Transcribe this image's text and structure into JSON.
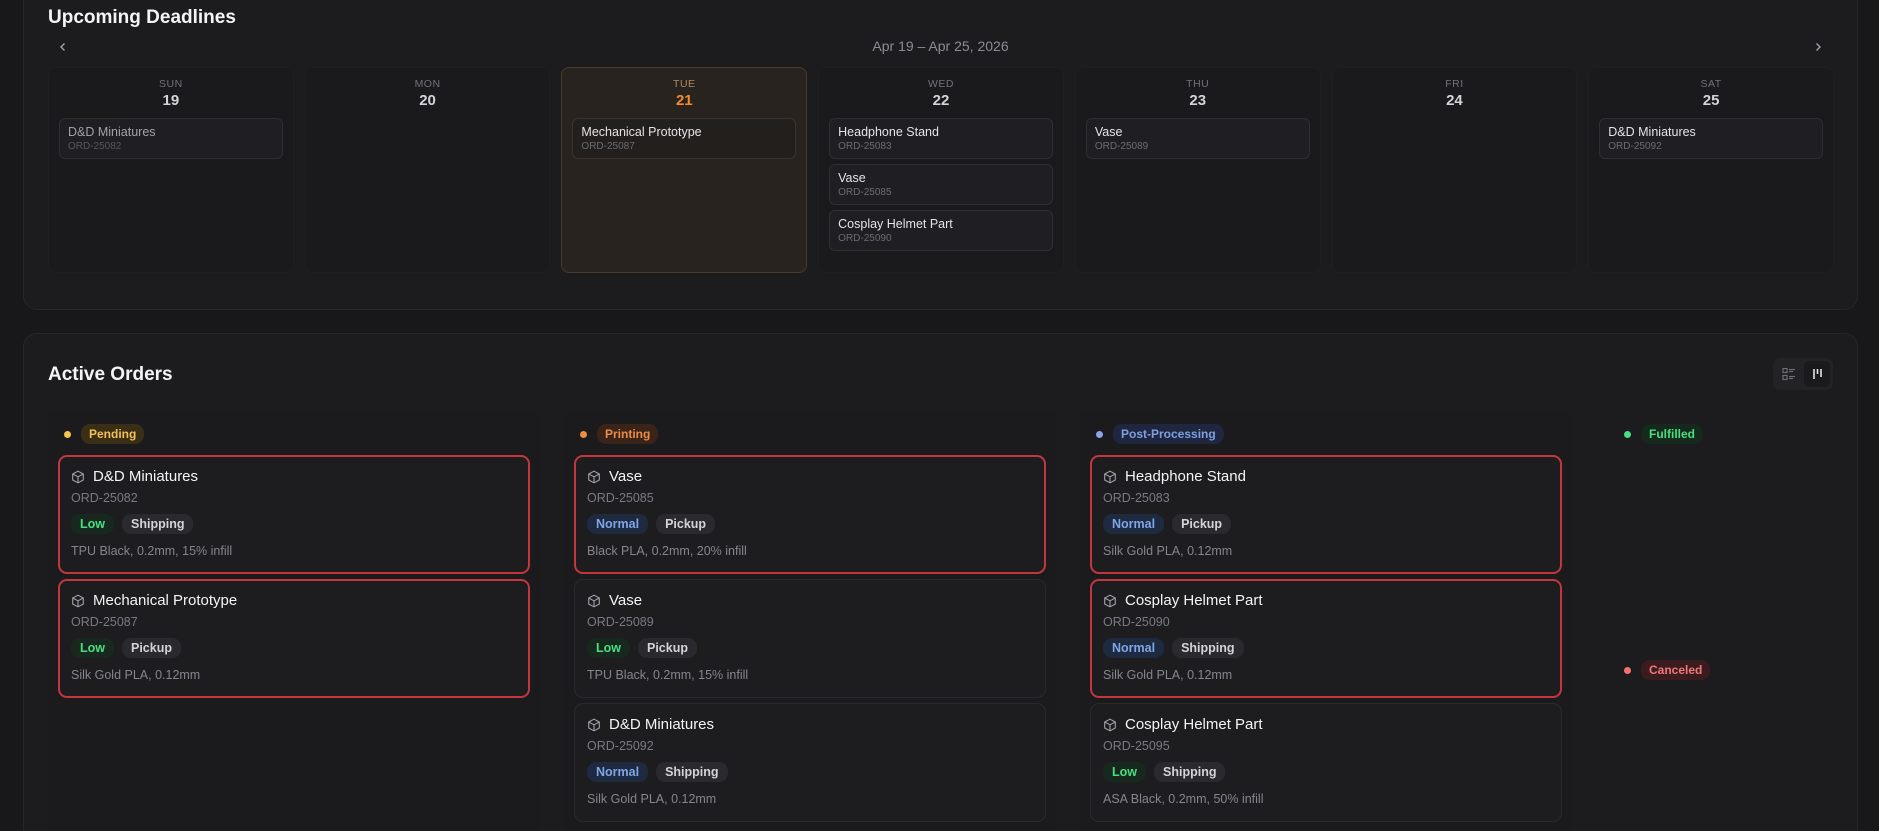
{
  "deadlines": {
    "title": "Upcoming Deadlines",
    "range": "Apr 19 – Apr 25, 2026",
    "days": [
      {
        "dow": "SUN",
        "num": "19",
        "today": false,
        "muted": true,
        "events": [
          {
            "title": "D&D Miniatures",
            "id": "ORD-25082"
          }
        ]
      },
      {
        "dow": "MON",
        "num": "20",
        "today": false,
        "muted": false,
        "events": []
      },
      {
        "dow": "TUE",
        "num": "21",
        "today": true,
        "muted": false,
        "events": [
          {
            "title": "Mechanical Prototype",
            "id": "ORD-25087"
          }
        ]
      },
      {
        "dow": "WED",
        "num": "22",
        "today": false,
        "muted": false,
        "events": [
          {
            "title": "Headphone Stand",
            "id": "ORD-25083"
          },
          {
            "title": "Vase",
            "id": "ORD-25085"
          },
          {
            "title": "Cosplay Helmet Part",
            "id": "ORD-25090"
          }
        ]
      },
      {
        "dow": "THU",
        "num": "23",
        "today": false,
        "muted": false,
        "events": [
          {
            "title": "Vase",
            "id": "ORD-25089"
          }
        ]
      },
      {
        "dow": "FRI",
        "num": "24",
        "today": false,
        "muted": false,
        "events": []
      },
      {
        "dow": "SAT",
        "num": "25",
        "today": false,
        "muted": false,
        "events": [
          {
            "title": "D&D Miniatures",
            "id": "ORD-25092"
          }
        ]
      }
    ]
  },
  "orders": {
    "title": "Active Orders",
    "view_icons": [
      "list-view-icon",
      "board-view-icon"
    ],
    "columns": [
      {
        "status": "Pending",
        "dot": "#f5c451",
        "pill_bg": "#3a2f15",
        "pill_fg": "#f0c05a",
        "cards": [
          {
            "title": "D&D Miniatures",
            "id": "ORD-25082",
            "priority": "Low",
            "method": "Shipping",
            "spec": "TPU Black, 0.2mm, 15% infill",
            "overdue": true
          },
          {
            "title": "Mechanical Prototype",
            "id": "ORD-25087",
            "priority": "Low",
            "method": "Pickup",
            "spec": "Silk Gold PLA, 0.12mm",
            "overdue": true
          }
        ]
      },
      {
        "status": "Printing",
        "dot": "#f08c3c",
        "pill_bg": "#3a2418",
        "pill_fg": "#ee8a4a",
        "cards": [
          {
            "title": "Vase",
            "id": "ORD-25085",
            "priority": "Normal",
            "method": "Pickup",
            "spec": "Black PLA, 0.2mm, 20% infill",
            "overdue": true
          },
          {
            "title": "Vase",
            "id": "ORD-25089",
            "priority": "Low",
            "method": "Pickup",
            "spec": "TPU Black, 0.2mm, 15% infill",
            "overdue": false
          },
          {
            "title": "D&D Miniatures",
            "id": "ORD-25092",
            "priority": "Normal",
            "method": "Shipping",
            "spec": "Silk Gold PLA, 0.12mm",
            "overdue": false
          }
        ]
      },
      {
        "status": "Post-Processing",
        "dot": "#8aa4e8",
        "pill_bg": "#1f2740",
        "pill_fg": "#7f9ee0",
        "cards": [
          {
            "title": "Headphone Stand",
            "id": "ORD-25083",
            "priority": "Normal",
            "method": "Pickup",
            "spec": "Silk Gold PLA, 0.12mm",
            "overdue": true
          },
          {
            "title": "Cosplay Helmet Part",
            "id": "ORD-25090",
            "priority": "Normal",
            "method": "Shipping",
            "spec": "Silk Gold PLA, 0.12mm",
            "overdue": true
          },
          {
            "title": "Cosplay Helmet Part",
            "id": "ORD-25095",
            "priority": "Low",
            "method": "Shipping",
            "spec": "ASA Black, 0.2mm, 50% infill",
            "overdue": false
          }
        ]
      }
    ],
    "side_columns": [
      {
        "status": "Fulfilled",
        "dot": "#4ade80",
        "pill_bg": "#15291d",
        "pill_fg": "#4ade80"
      },
      {
        "status": "Canceled",
        "dot": "#f87171",
        "pill_bg": "#3a1c1f",
        "pill_fg": "#f07878"
      }
    ]
  }
}
